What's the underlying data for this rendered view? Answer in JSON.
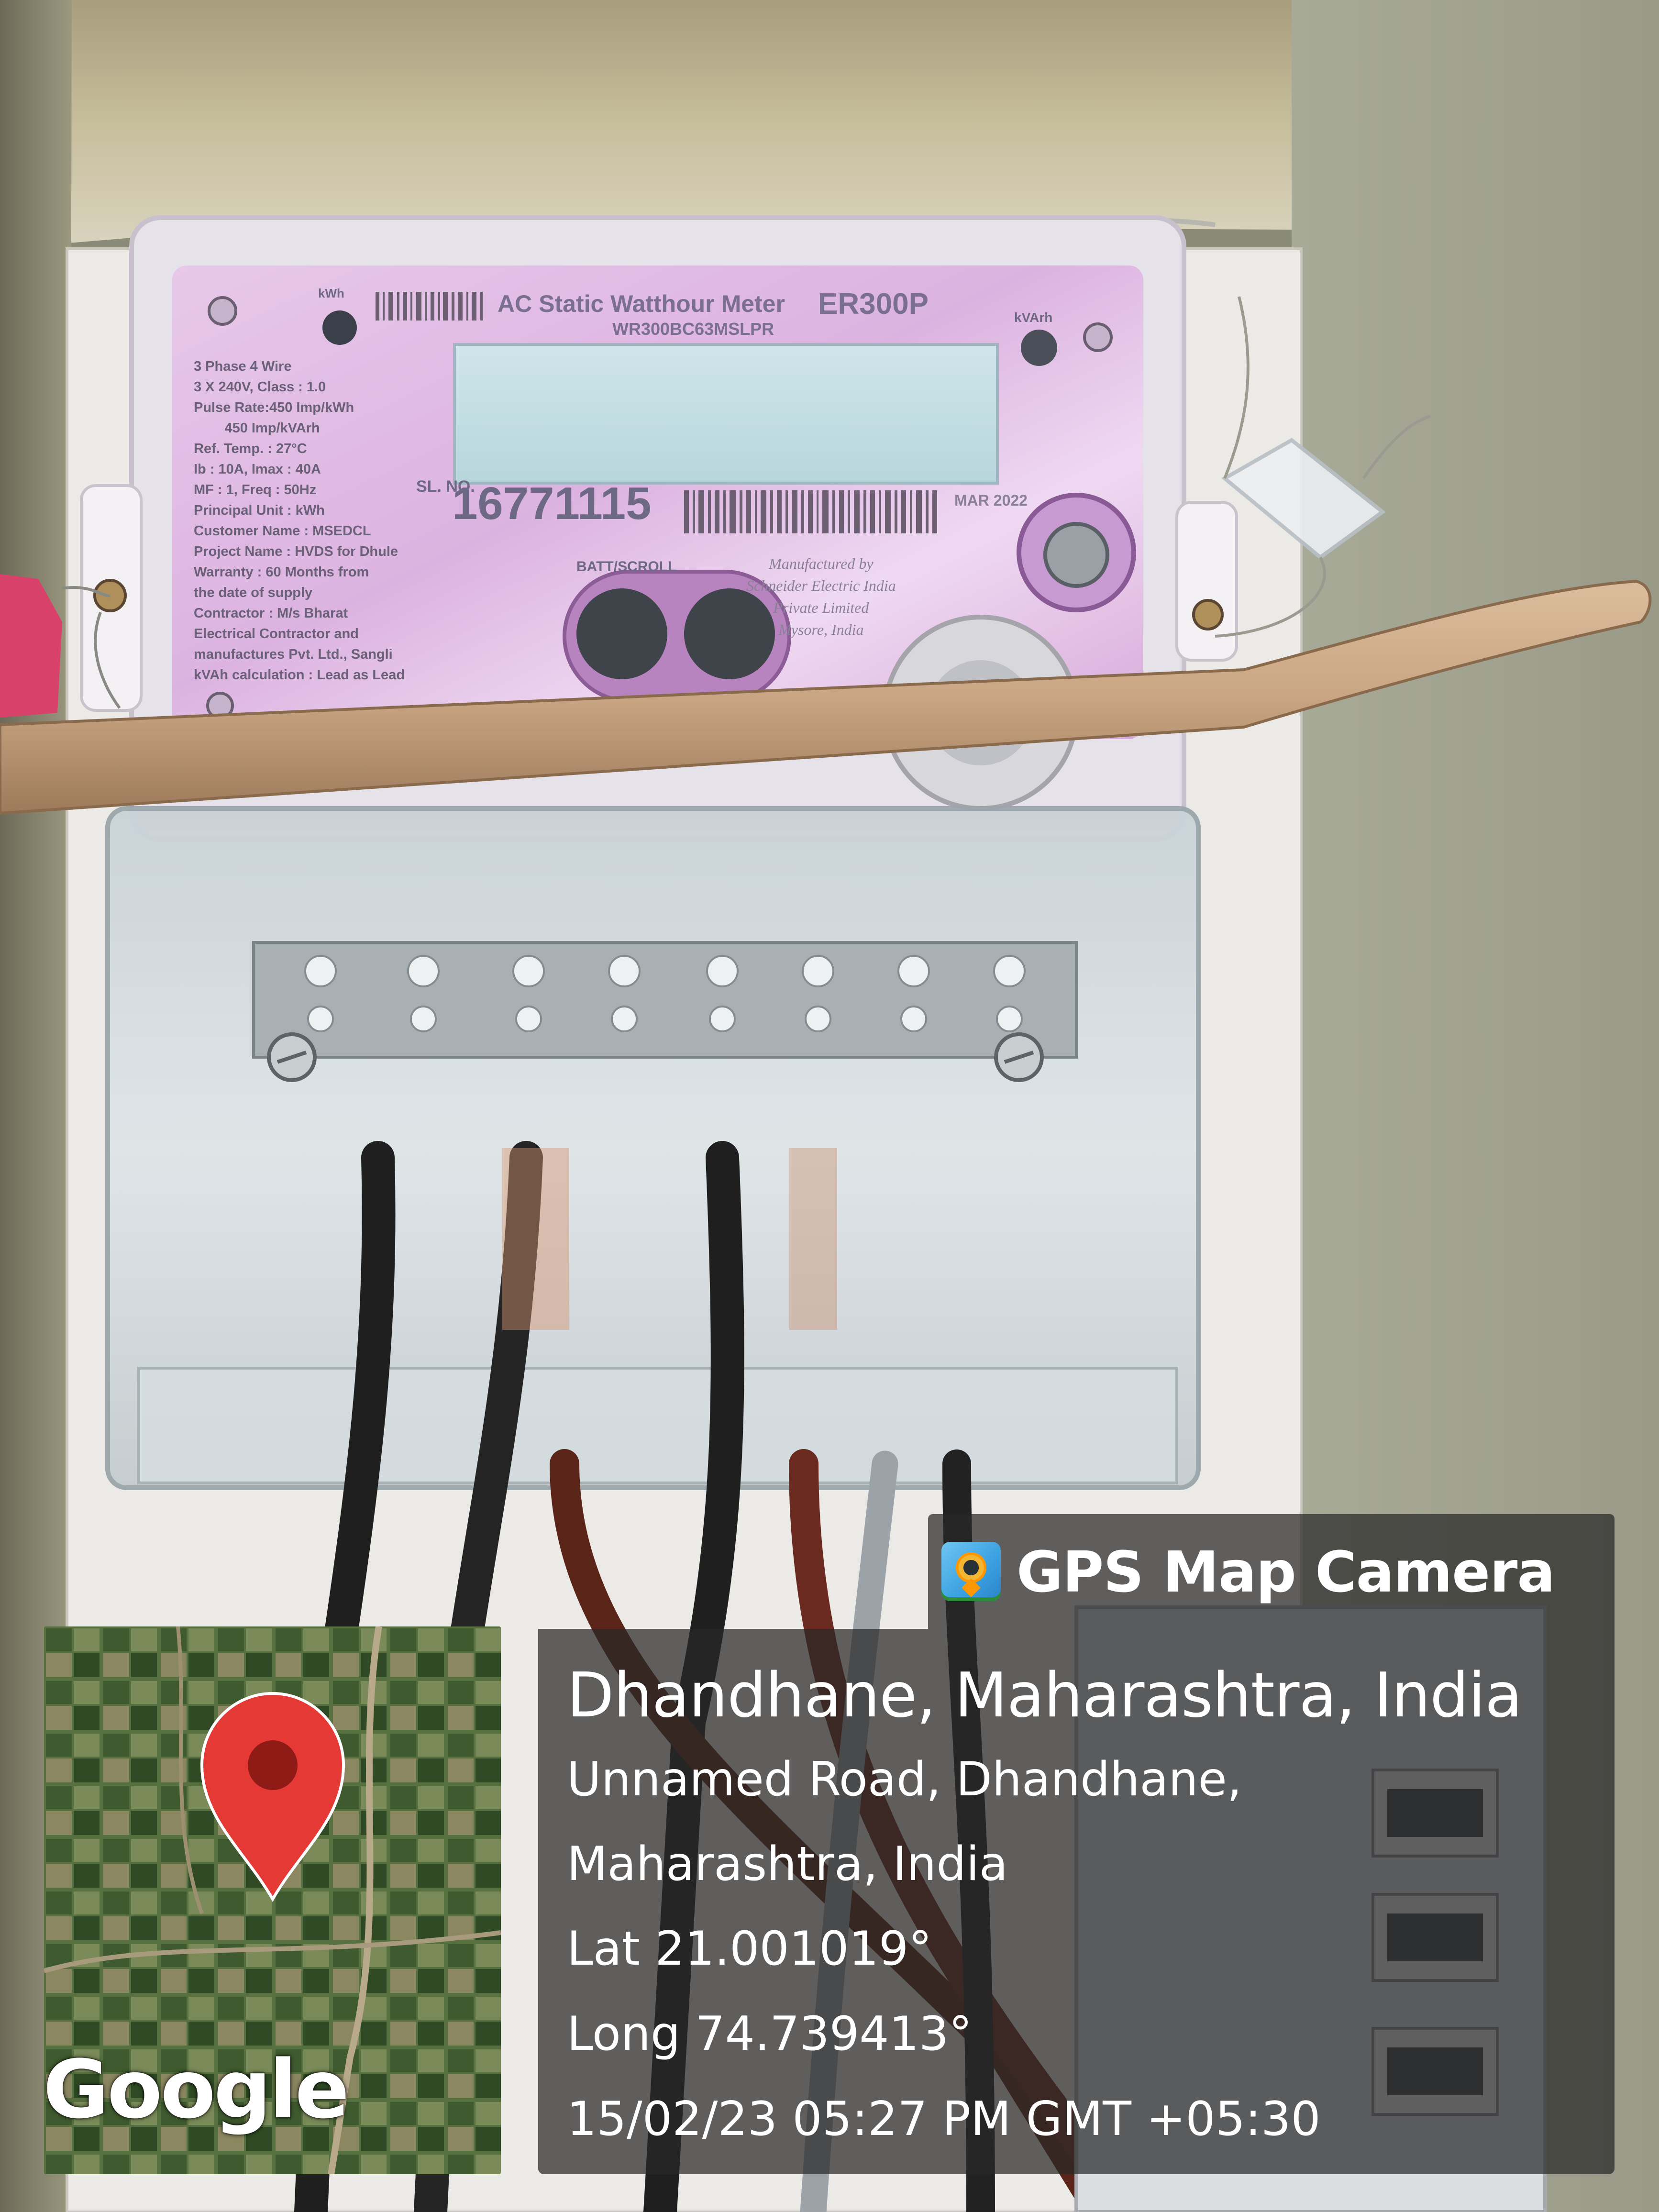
{
  "meter": {
    "title": "AC Static Watthour Meter",
    "model": "ER300P",
    "code": "WR300BC63MSLPR",
    "serial_label": "SL. NO.",
    "serial": "16771115",
    "kwh_label": "kWh",
    "kvarh_label": "kVArh",
    "batt_label": "BATT/SCROLL",
    "date": "MAR 2022",
    "spec": "3 Phase 4 Wire\n3 X 240V, Class : 1.0\nPulse Rate:450 Imp/kWh\n        450 Imp/kVArh\nRef. Temp. : 27°C\nIb : 10A, Imax : 40A\nMF : 1, Freq : 50Hz\nPrincipal Unit : kWh\nCustomer Name : MSEDCL\nProject Name : HVDS for Dhule\nWarranty : 60 Months from\nthe date of supply\nContractor : M/s Bharat\nElectrical Contractor and\nmanufactures Pvt. Ltd., Sangli\nkVAh calculation : Lead as Lead",
    "manufacturer": "Manufactured by\nSchneider Electric India\nPrivate Limited\nMysore, India"
  },
  "gps": {
    "app_name": "GPS Map Camera",
    "icon": "gps-map-camera-icon",
    "title": "Dhandhane, Maharashtra, India",
    "address_line1": "Unnamed Road, Dhandhane,",
    "address_line2": "Maharashtra, India",
    "lat": "Lat 21.001019°",
    "long": "Long 74.739413°",
    "datetime": "15/02/23 05:27 PM GMT +05:30"
  },
  "map": {
    "logo": "Google",
    "pin_color": "#e53935"
  },
  "colors": {
    "panel_bg": "#282828",
    "meter_pink": "#d8a8d8",
    "wire_brown": "#6b2a1f",
    "wire_black": "#1c1c1c",
    "stick": "#c9a583"
  }
}
